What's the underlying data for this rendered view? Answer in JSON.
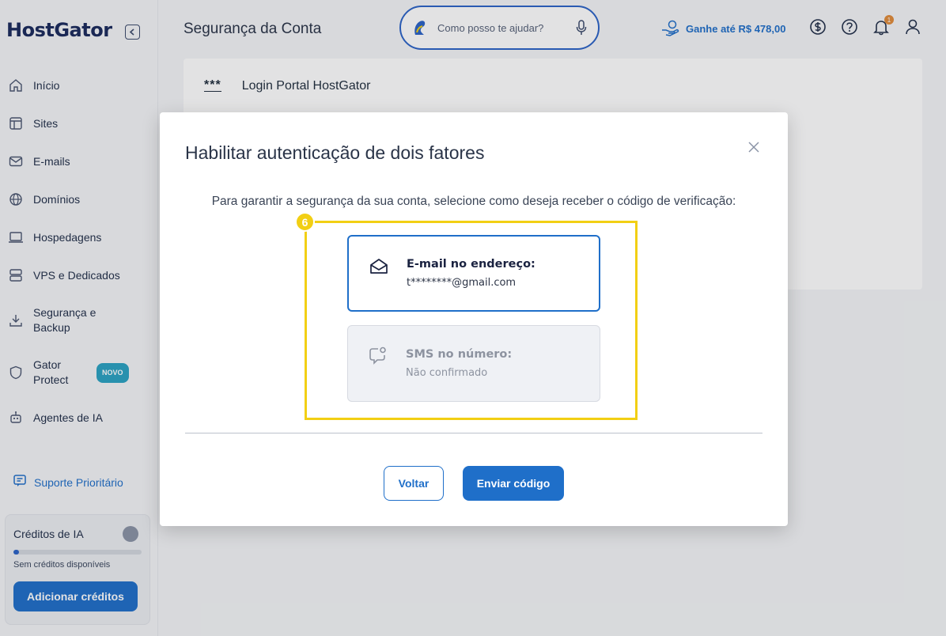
{
  "app": {
    "logo": "HostGator"
  },
  "sidebar": {
    "items": [
      {
        "label": "Início",
        "icon": "home-icon"
      },
      {
        "label": "Sites",
        "icon": "layout-icon"
      },
      {
        "label": "E-mails",
        "icon": "mail-icon"
      },
      {
        "label": "Domínios",
        "icon": "globe-icon"
      },
      {
        "label": "Hospedagens",
        "icon": "laptop-icon"
      },
      {
        "label": "VPS e Dedicados",
        "icon": "server-icon"
      },
      {
        "label": "Segurança e Backup",
        "icon": "download-icon"
      },
      {
        "label": "Gator Protect",
        "icon": "shield-icon",
        "badge": "NOVO"
      },
      {
        "label": "Agentes de IA",
        "icon": "robot-icon"
      }
    ],
    "support_label": "Suporte Prioritário",
    "credits": {
      "title": "Créditos de IA",
      "status": "Sem créditos disponíveis",
      "button_label": "Adicionar créditos",
      "progress": 0.04
    }
  },
  "header": {
    "page_title": "Segurança da Conta",
    "search_placeholder": "Como posso te ajudar?",
    "referral_label": "Ganhe até R$ 478,00",
    "notification_count": "1"
  },
  "content": {
    "row_marker": "***",
    "row_label": "Login Portal HostGator"
  },
  "modal": {
    "title": "Habilitar autenticação de dois fatores",
    "description": "Para garantir a segurança da sua conta, selecione como deseja receber o código de verificação:",
    "step_number": "6",
    "options": [
      {
        "title": "E-mail no endereço:",
        "value": "t********@gmail.com",
        "icon": "envelope-open-icon",
        "selected": true
      },
      {
        "title": "SMS no número:",
        "value": "Não confirmado",
        "icon": "message-bubble-icon",
        "selected": false
      }
    ],
    "back_label": "Voltar",
    "send_label": "Enviar código"
  },
  "colors": {
    "accent": "#1f6fc9",
    "highlight": "#f2cf14",
    "brand": "#1a2a5c"
  }
}
